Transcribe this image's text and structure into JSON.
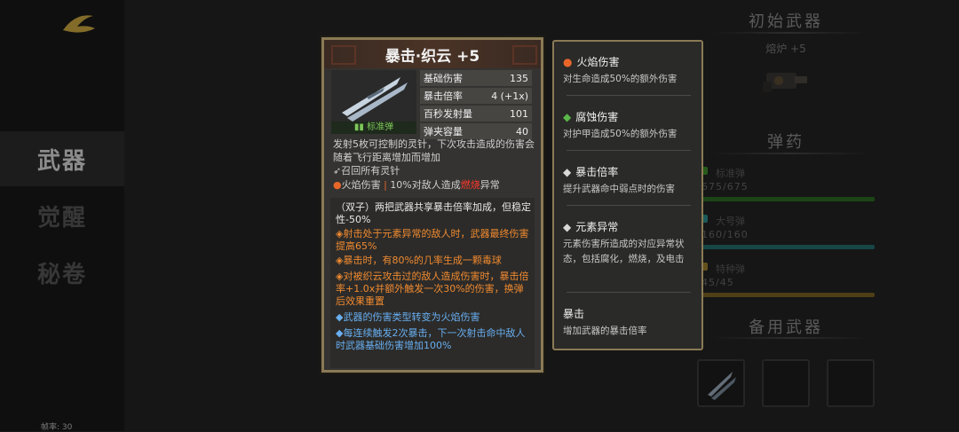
{
  "nav": {
    "items": [
      {
        "label": "武器",
        "active": true
      },
      {
        "label": "觉醒",
        "active": false
      },
      {
        "label": "秘卷",
        "active": false
      }
    ],
    "fps": "帧率: 30"
  },
  "right_panel": {
    "initial_weapon_title": "初始武器",
    "furnace_label": "熔炉 +5",
    "ammo_title": "弹药",
    "ammo": [
      {
        "name": "标准弹",
        "count": "675/675",
        "color": "#3c8a2a"
      },
      {
        "name": "大号弹",
        "count": "160/160",
        "color": "#2a8a8a"
      },
      {
        "name": "特种弹",
        "count": "45/45",
        "color": "#9a7c2a"
      }
    ],
    "backup_weapon_title": "备用武器"
  },
  "weapon": {
    "title": "暴击·织云 +5",
    "ammo_type": "标准弹",
    "stats": [
      {
        "label": "基础伤害",
        "value": "135"
      },
      {
        "label": "暴击倍率",
        "value": "4 (+1x)"
      },
      {
        "label": "百秒发射量",
        "value": "101"
      },
      {
        "label": "弹夹容量",
        "value": "40"
      }
    ],
    "description": "发射5枚可控制的灵针，下次攻击造成的伤害会随着飞行距离增加而增加",
    "recall": "召回所有灵针",
    "fire_effect_name": "火焰伤害",
    "fire_effect_text_pre": "10%对敌人造成",
    "fire_effect_highlight": "燃烧",
    "fire_effect_text_post": "异常",
    "effects": [
      {
        "text": "（双子）两把武器共享暴击倍率加成，但稳定性-50%",
        "color": "white"
      },
      {
        "text": "◈射击处于元素异常的敌人时，武器最终伤害提高65%",
        "color": "orange"
      },
      {
        "text": "◈暴击时，有80%的几率生成一颗毒球",
        "color": "orange"
      },
      {
        "text": "◈对被织云攻击过的敌人造成伤害时，暴击倍率+1.0x并额外触发一次30%的伤害，换弹后效果重置",
        "color": "orange"
      },
      {
        "text": "◆武器的伤害类型转变为火焰伤害",
        "color": "blue"
      },
      {
        "text": "◆每连续触发2次暴击，下一次射击命中敌人时武器基础伤害增加100%",
        "color": "blue"
      }
    ]
  },
  "keywords": [
    {
      "icon": "fire",
      "name": "火焰伤害",
      "text": "对生命造成50%的额外伤害"
    },
    {
      "icon": "corrosion",
      "name": "腐蚀伤害",
      "text": "对护甲造成50%的额外伤害"
    },
    {
      "icon": "diamond",
      "name": "暴击倍率",
      "text": "提升武器命中弱点时的伤害"
    },
    {
      "icon": "diamond",
      "name": "元素异常",
      "text": "元素伤害所造成的对应异常状态，包括腐化，燃烧，及电击"
    },
    {
      "icon": "none",
      "name": "暴击",
      "text": "增加武器的暴击倍率"
    }
  ]
}
